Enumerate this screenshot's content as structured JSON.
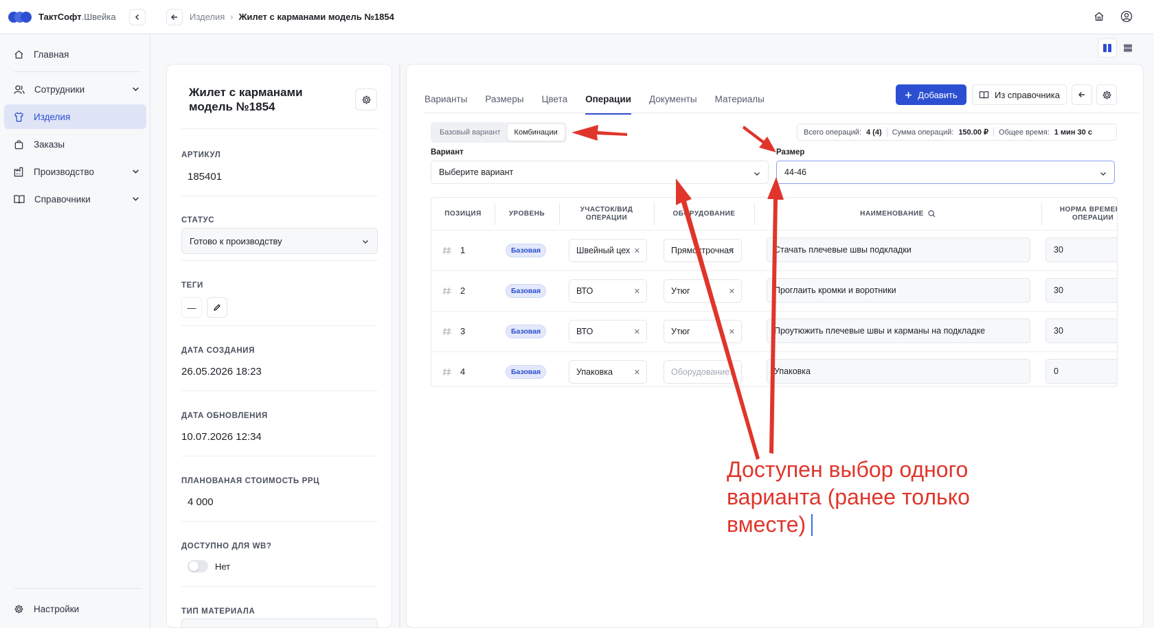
{
  "app": {
    "brand": "ТактСофт",
    "brand_sub": ".Швейка"
  },
  "breadcrumb": {
    "parent": "Изделия",
    "current": "Жилет с карманами модель №1854"
  },
  "sidebar": {
    "items": [
      {
        "label": "Главная",
        "icon": "home-icon"
      },
      {
        "label": "Сотрудники",
        "icon": "users-icon"
      },
      {
        "label": "Изделия",
        "icon": "shirt-icon"
      },
      {
        "label": "Заказы",
        "icon": "bag-icon"
      },
      {
        "label": "Производство",
        "icon": "factory-icon"
      },
      {
        "label": "Справочники",
        "icon": "book-icon"
      }
    ],
    "settings": "Настройки"
  },
  "product": {
    "title": "Жилет с карманами модель №1854",
    "fields": {
      "article_label": "АРТИКУЛ",
      "article": "185401",
      "status_label": "СТАТУС",
      "status": "Готово к производству",
      "tags_label": "ТЕГИ",
      "tags_empty": "—",
      "created_label": "ДАТА СОЗДАНИЯ",
      "created": "26.05.2026 18:23",
      "updated_label": "ДАТА ОБНОВЛЕНИЯ",
      "updated": "10.07.2026 12:34",
      "cost_label": "ПЛАНОВАНАЯ СТОИМОСТЬ РРЦ",
      "cost": "4 000",
      "wb_label": "ДОСТУПНО ДЛЯ WB?",
      "wb": "Нет",
      "material_label": "ТИП МАТЕРИАЛА"
    }
  },
  "tabs": [
    "Варианты",
    "Размеры",
    "Цвета",
    "Операции",
    "Документы",
    "Материалы"
  ],
  "active_tab": "Операции",
  "actions": {
    "add": "Добавить",
    "from_ref": "Из справочника"
  },
  "segment": {
    "options": [
      "Базовый вариант",
      "Комбинации"
    ],
    "active": "Комбинации"
  },
  "stats": {
    "total_label": "Всего операций:",
    "total": "4 (4)",
    "sum_label": "Сумма операций:",
    "sum": "150.00 ₽",
    "time_label": "Общее время:",
    "time": "1 мин 30 с"
  },
  "variant": {
    "label": "Вариант",
    "value": "Выберите вариант"
  },
  "size": {
    "label": "Размер",
    "value": "44-46"
  },
  "table": {
    "headers": {
      "position": "ПОЗИЦИЯ",
      "level": "УРОВЕНЬ",
      "section_a": "УЧАСТОК/ВИД",
      "section_b": "ОПЕРАЦИИ",
      "equipment": "ОБОРУДОВАНИЕ",
      "name": "НАИМЕНОВАНИЕ",
      "norm_a": "НОРМА ВРЕМЕНИ",
      "norm_b": "ОПЕРАЦИИ"
    },
    "rows": [
      {
        "pos": "1",
        "level": "Базовая",
        "section": "Швейный цех",
        "equipment": "Прямострочная",
        "name": "Стачать плечевые швы подкладки",
        "norm": "30"
      },
      {
        "pos": "2",
        "level": "Базовая",
        "section": "ВТО",
        "equipment": "Утюг",
        "name": "Проглаить кромки и воротники",
        "norm": "30"
      },
      {
        "pos": "3",
        "level": "Базовая",
        "section": "ВТО",
        "equipment": "Утюг",
        "name": "Проутюжить плечевые швы и карманы на подкладке",
        "norm": "30"
      },
      {
        "pos": "4",
        "level": "Базовая",
        "section": "Упаковка",
        "equipment": "",
        "equipment_placeholder": "Оборудование...",
        "name": "Упаковка",
        "norm": "0"
      }
    ]
  },
  "annotation": {
    "line1": "Доступен выбор одного",
    "line2": "варианта (ранее только",
    "line3": "вместе)"
  },
  "colors": {
    "accent": "#2c4fd2",
    "annotation": "#e0352b",
    "active_nav_bg": "#dfe5f6"
  }
}
